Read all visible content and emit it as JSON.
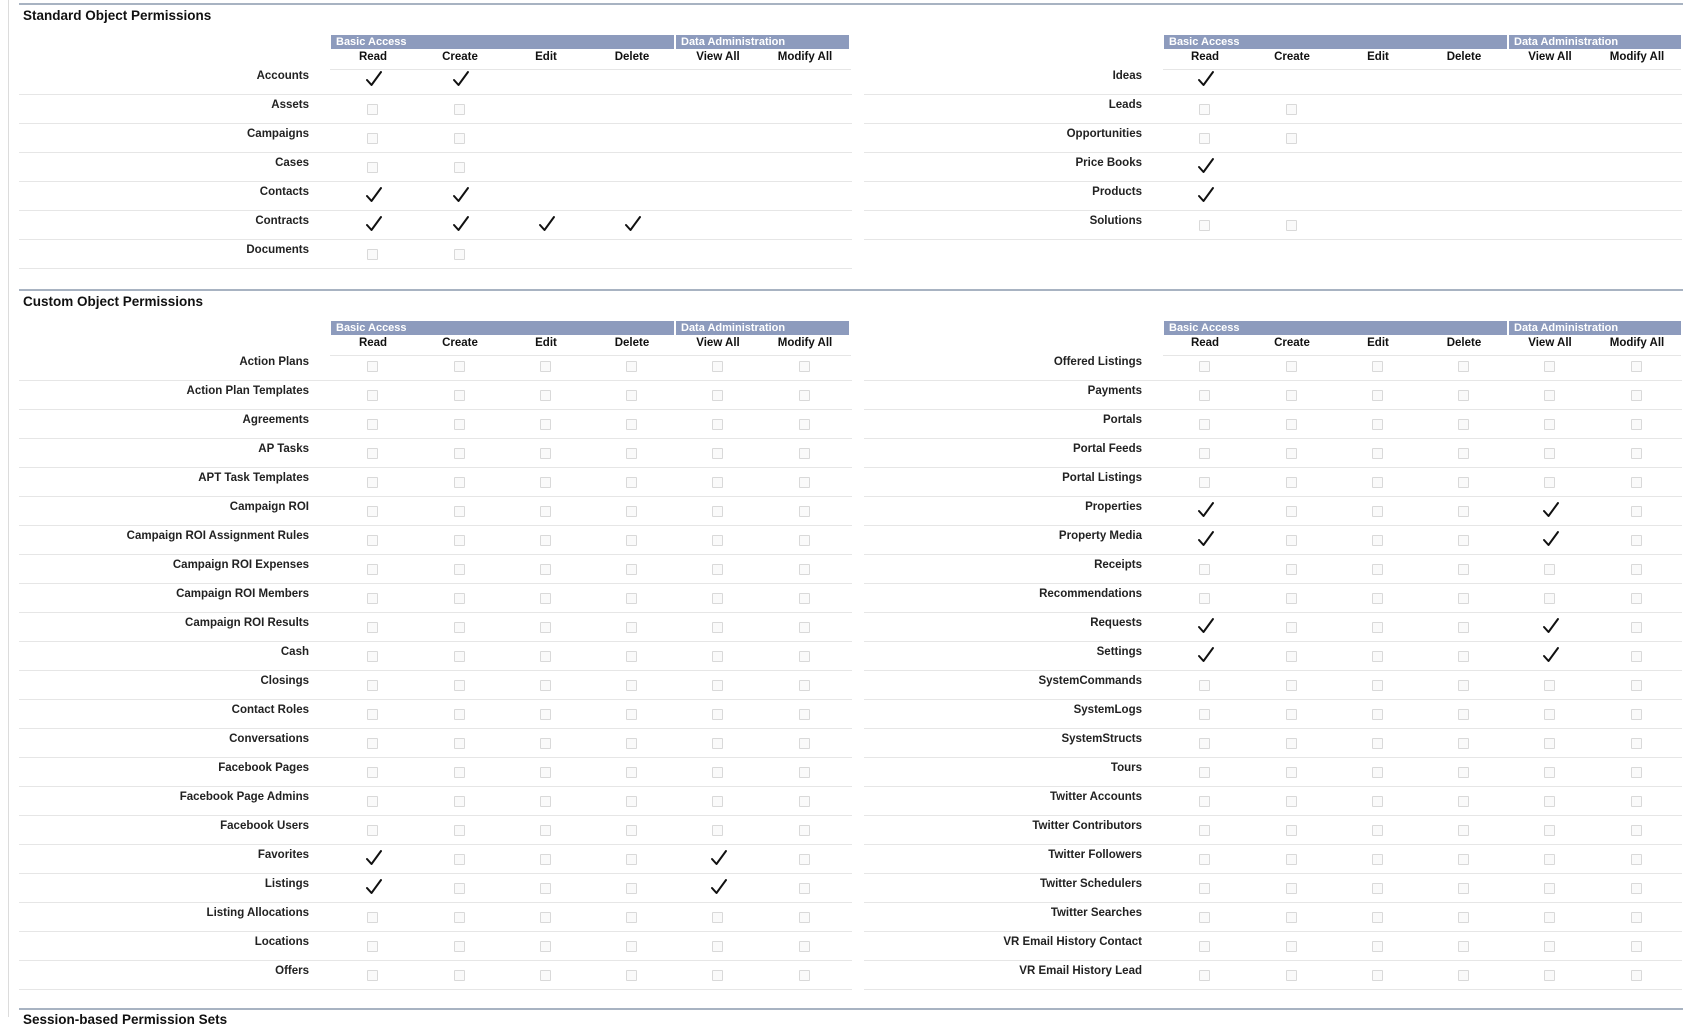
{
  "column_groups": {
    "basic_access": "Basic Access",
    "data_administration": "Data Administration"
  },
  "columns": [
    "Read",
    "Create",
    "Edit",
    "Delete",
    "View All",
    "Modify All"
  ],
  "sections": [
    {
      "title": "Standard Object Permissions",
      "panels": [
        {
          "rows": [
            {
              "name": "Accounts",
              "perms": [
                "checked",
                "checked",
                "none",
                "none",
                "none",
                "none"
              ]
            },
            {
              "name": "Assets",
              "perms": [
                "unchecked",
                "unchecked",
                "none",
                "none",
                "none",
                "none"
              ]
            },
            {
              "name": "Campaigns",
              "perms": [
                "unchecked",
                "unchecked",
                "none",
                "none",
                "none",
                "none"
              ]
            },
            {
              "name": "Cases",
              "perms": [
                "unchecked",
                "unchecked",
                "none",
                "none",
                "none",
                "none"
              ]
            },
            {
              "name": "Contacts",
              "perms": [
                "checked",
                "checked",
                "none",
                "none",
                "none",
                "none"
              ]
            },
            {
              "name": "Contracts",
              "perms": [
                "checked",
                "checked",
                "checked",
                "checked",
                "none",
                "none"
              ]
            },
            {
              "name": "Documents",
              "perms": [
                "unchecked",
                "unchecked",
                "none",
                "none",
                "none",
                "none"
              ]
            }
          ]
        },
        {
          "rows": [
            {
              "name": "Ideas",
              "perms": [
                "checked",
                "none",
                "none",
                "none",
                "none",
                "none"
              ]
            },
            {
              "name": "Leads",
              "perms": [
                "unchecked",
                "unchecked",
                "none",
                "none",
                "none",
                "none"
              ]
            },
            {
              "name": "Opportunities",
              "perms": [
                "unchecked",
                "unchecked",
                "none",
                "none",
                "none",
                "none"
              ]
            },
            {
              "name": "Price Books",
              "perms": [
                "checked",
                "none",
                "none",
                "none",
                "none",
                "none"
              ]
            },
            {
              "name": "Products",
              "perms": [
                "checked",
                "none",
                "none",
                "none",
                "none",
                "none"
              ]
            },
            {
              "name": "Solutions",
              "perms": [
                "unchecked",
                "unchecked",
                "none",
                "none",
                "none",
                "none"
              ]
            }
          ]
        }
      ]
    },
    {
      "title": "Custom Object Permissions",
      "panels": [
        {
          "rows": [
            {
              "name": "Action Plans",
              "perms": [
                "unchecked",
                "unchecked",
                "unchecked",
                "unchecked",
                "unchecked",
                "unchecked"
              ]
            },
            {
              "name": "Action Plan Templates",
              "perms": [
                "unchecked",
                "unchecked",
                "unchecked",
                "unchecked",
                "unchecked",
                "unchecked"
              ]
            },
            {
              "name": "Agreements",
              "perms": [
                "unchecked",
                "unchecked",
                "unchecked",
                "unchecked",
                "unchecked",
                "unchecked"
              ]
            },
            {
              "name": "AP Tasks",
              "perms": [
                "unchecked",
                "unchecked",
                "unchecked",
                "unchecked",
                "unchecked",
                "unchecked"
              ]
            },
            {
              "name": "APT Task Templates",
              "perms": [
                "unchecked",
                "unchecked",
                "unchecked",
                "unchecked",
                "unchecked",
                "unchecked"
              ]
            },
            {
              "name": "Campaign ROI",
              "perms": [
                "unchecked",
                "unchecked",
                "unchecked",
                "unchecked",
                "unchecked",
                "unchecked"
              ]
            },
            {
              "name": "Campaign ROI Assignment Rules",
              "perms": [
                "unchecked",
                "unchecked",
                "unchecked",
                "unchecked",
                "unchecked",
                "unchecked"
              ]
            },
            {
              "name": "Campaign ROI Expenses",
              "perms": [
                "unchecked",
                "unchecked",
                "unchecked",
                "unchecked",
                "unchecked",
                "unchecked"
              ]
            },
            {
              "name": "Campaign ROI Members",
              "perms": [
                "unchecked",
                "unchecked",
                "unchecked",
                "unchecked",
                "unchecked",
                "unchecked"
              ]
            },
            {
              "name": "Campaign ROI Results",
              "perms": [
                "unchecked",
                "unchecked",
                "unchecked",
                "unchecked",
                "unchecked",
                "unchecked"
              ]
            },
            {
              "name": "Cash",
              "perms": [
                "unchecked",
                "unchecked",
                "unchecked",
                "unchecked",
                "unchecked",
                "unchecked"
              ]
            },
            {
              "name": "Closings",
              "perms": [
                "unchecked",
                "unchecked",
                "unchecked",
                "unchecked",
                "unchecked",
                "unchecked"
              ]
            },
            {
              "name": "Contact Roles",
              "perms": [
                "unchecked",
                "unchecked",
                "unchecked",
                "unchecked",
                "unchecked",
                "unchecked"
              ]
            },
            {
              "name": "Conversations",
              "perms": [
                "unchecked",
                "unchecked",
                "unchecked",
                "unchecked",
                "unchecked",
                "unchecked"
              ]
            },
            {
              "name": "Facebook Pages",
              "perms": [
                "unchecked",
                "unchecked",
                "unchecked",
                "unchecked",
                "unchecked",
                "unchecked"
              ]
            },
            {
              "name": "Facebook Page Admins",
              "perms": [
                "unchecked",
                "unchecked",
                "unchecked",
                "unchecked",
                "unchecked",
                "unchecked"
              ]
            },
            {
              "name": "Facebook Users",
              "perms": [
                "unchecked",
                "unchecked",
                "unchecked",
                "unchecked",
                "unchecked",
                "unchecked"
              ]
            },
            {
              "name": "Favorites",
              "perms": [
                "checked",
                "unchecked",
                "unchecked",
                "unchecked",
                "checked",
                "unchecked"
              ]
            },
            {
              "name": "Listings",
              "perms": [
                "checked",
                "unchecked",
                "unchecked",
                "unchecked",
                "checked",
                "unchecked"
              ]
            },
            {
              "name": "Listing Allocations",
              "perms": [
                "unchecked",
                "unchecked",
                "unchecked",
                "unchecked",
                "unchecked",
                "unchecked"
              ]
            },
            {
              "name": "Locations",
              "perms": [
                "unchecked",
                "unchecked",
                "unchecked",
                "unchecked",
                "unchecked",
                "unchecked"
              ]
            },
            {
              "name": "Offers",
              "perms": [
                "unchecked",
                "unchecked",
                "unchecked",
                "unchecked",
                "unchecked",
                "unchecked"
              ]
            }
          ]
        },
        {
          "rows": [
            {
              "name": "Offered Listings",
              "perms": [
                "unchecked",
                "unchecked",
                "unchecked",
                "unchecked",
                "unchecked",
                "unchecked"
              ]
            },
            {
              "name": "Payments",
              "perms": [
                "unchecked",
                "unchecked",
                "unchecked",
                "unchecked",
                "unchecked",
                "unchecked"
              ]
            },
            {
              "name": "Portals",
              "perms": [
                "unchecked",
                "unchecked",
                "unchecked",
                "unchecked",
                "unchecked",
                "unchecked"
              ]
            },
            {
              "name": "Portal Feeds",
              "perms": [
                "unchecked",
                "unchecked",
                "unchecked",
                "unchecked",
                "unchecked",
                "unchecked"
              ]
            },
            {
              "name": "Portal Listings",
              "perms": [
                "unchecked",
                "unchecked",
                "unchecked",
                "unchecked",
                "unchecked",
                "unchecked"
              ]
            },
            {
              "name": "Properties",
              "perms": [
                "checked",
                "unchecked",
                "unchecked",
                "unchecked",
                "checked",
                "unchecked"
              ]
            },
            {
              "name": "Property Media",
              "perms": [
                "checked",
                "unchecked",
                "unchecked",
                "unchecked",
                "checked",
                "unchecked"
              ]
            },
            {
              "name": "Receipts",
              "perms": [
                "unchecked",
                "unchecked",
                "unchecked",
                "unchecked",
                "unchecked",
                "unchecked"
              ]
            },
            {
              "name": "Recommendations",
              "perms": [
                "unchecked",
                "unchecked",
                "unchecked",
                "unchecked",
                "unchecked",
                "unchecked"
              ]
            },
            {
              "name": "Requests",
              "perms": [
                "checked",
                "unchecked",
                "unchecked",
                "unchecked",
                "checked",
                "unchecked"
              ]
            },
            {
              "name": "Settings",
              "perms": [
                "checked",
                "unchecked",
                "unchecked",
                "unchecked",
                "checked",
                "unchecked"
              ]
            },
            {
              "name": "SystemCommands",
              "perms": [
                "unchecked",
                "unchecked",
                "unchecked",
                "unchecked",
                "unchecked",
                "unchecked"
              ]
            },
            {
              "name": "SystemLogs",
              "perms": [
                "unchecked",
                "unchecked",
                "unchecked",
                "unchecked",
                "unchecked",
                "unchecked"
              ]
            },
            {
              "name": "SystemStructs",
              "perms": [
                "unchecked",
                "unchecked",
                "unchecked",
                "unchecked",
                "unchecked",
                "unchecked"
              ]
            },
            {
              "name": "Tours",
              "perms": [
                "unchecked",
                "unchecked",
                "unchecked",
                "unchecked",
                "unchecked",
                "unchecked"
              ]
            },
            {
              "name": "Twitter Accounts",
              "perms": [
                "unchecked",
                "unchecked",
                "unchecked",
                "unchecked",
                "unchecked",
                "unchecked"
              ]
            },
            {
              "name": "Twitter Contributors",
              "perms": [
                "unchecked",
                "unchecked",
                "unchecked",
                "unchecked",
                "unchecked",
                "unchecked"
              ]
            },
            {
              "name": "Twitter Followers",
              "perms": [
                "unchecked",
                "unchecked",
                "unchecked",
                "unchecked",
                "unchecked",
                "unchecked"
              ]
            },
            {
              "name": "Twitter Schedulers",
              "perms": [
                "unchecked",
                "unchecked",
                "unchecked",
                "unchecked",
                "unchecked",
                "unchecked"
              ]
            },
            {
              "name": "Twitter Searches",
              "perms": [
                "unchecked",
                "unchecked",
                "unchecked",
                "unchecked",
                "unchecked",
                "unchecked"
              ]
            },
            {
              "name": "VR Email History Contact",
              "perms": [
                "unchecked",
                "unchecked",
                "unchecked",
                "unchecked",
                "unchecked",
                "unchecked"
              ]
            },
            {
              "name": "VR Email History Lead",
              "perms": [
                "unchecked",
                "unchecked",
                "unchecked",
                "unchecked",
                "unchecked",
                "unchecked"
              ]
            }
          ]
        }
      ]
    }
  ],
  "next_section_title": "Session-based Permission Sets",
  "colors": {
    "band": "#8d9bbd",
    "section_rule": "#a8b3c2",
    "row_line": "#e6e6e6"
  },
  "icons": {
    "checked": "checkmark-icon",
    "unchecked": "empty-checkbox"
  }
}
